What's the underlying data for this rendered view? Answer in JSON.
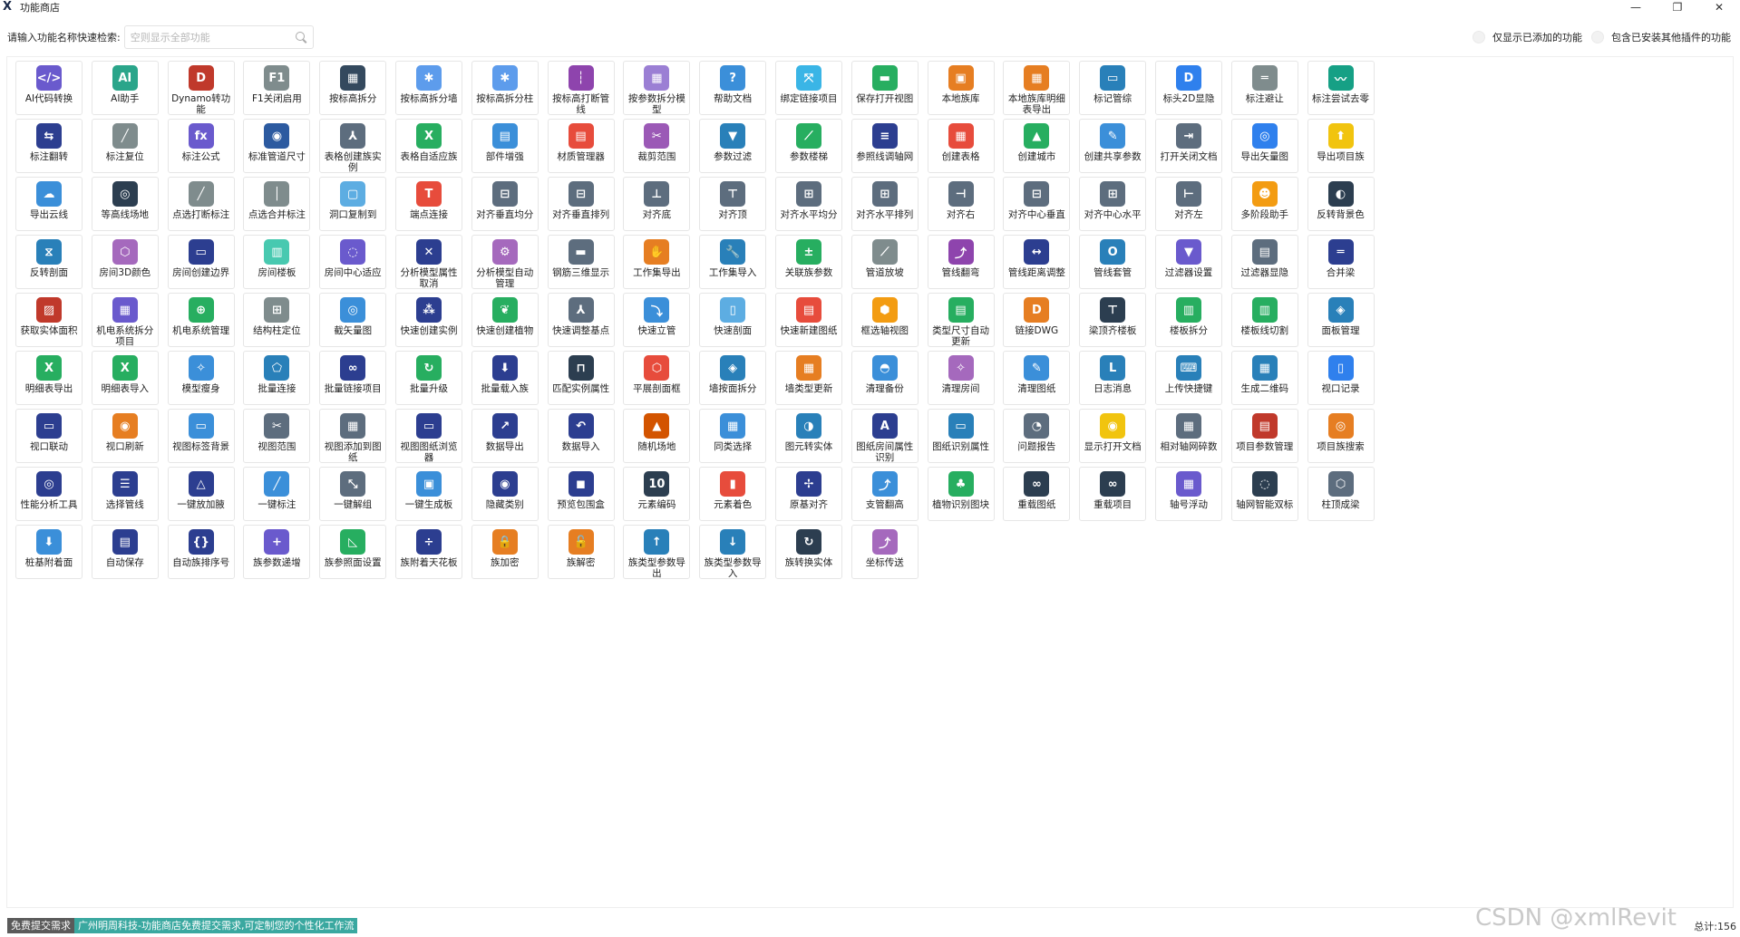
{
  "window": {
    "title": "功能商店",
    "app_icon": "X"
  },
  "search": {
    "label": "请输入功能名称快速检索:",
    "placeholder": "空则显示全部功能"
  },
  "toggles": [
    {
      "label": "仅显示已添加的功能"
    },
    {
      "label": "包含已安装其他插件的功能"
    }
  ],
  "footer": {
    "feedback": "免费提交需求",
    "banner": "广州明周科技-功能商店免费提交需求,可定制您的个性化工作流",
    "watermark": "CSDN @xmlRevit",
    "total": "总计:156"
  },
  "features": [
    {
      "label": "AI代码转换",
      "icon": "</>",
      "color": "#6a5acd"
    },
    {
      "label": "AI助手",
      "icon": "AI",
      "color": "#2aa58a"
    },
    {
      "label": "Dynamo转功能",
      "icon": "D",
      "color": "#c0392b"
    },
    {
      "label": "F1关闭启用",
      "icon": "F1",
      "color": "#7f8c8d"
    },
    {
      "label": "按标高拆分",
      "icon": "▦",
      "color": "#34495e"
    },
    {
      "label": "按标高拆分墙",
      "icon": "✱",
      "color": "#5d9cec"
    },
    {
      "label": "按标高拆分柱",
      "icon": "✱",
      "color": "#5d9cec"
    },
    {
      "label": "按标高打断管线",
      "icon": "┆",
      "color": "#8e44ad"
    },
    {
      "label": "按参数拆分模型",
      "icon": "▦",
      "color": "#9b7fd4"
    },
    {
      "label": "帮助文档",
      "icon": "?",
      "color": "#3b8fd9"
    },
    {
      "label": "绑定链接项目",
      "icon": "⤧",
      "color": "#3ab5e6"
    },
    {
      "label": "保存打开视图",
      "icon": "▬",
      "color": "#27ae60"
    },
    {
      "label": "本地族库",
      "icon": "▣",
      "color": "#e67e22"
    },
    {
      "label": "本地族库明细表导出",
      "icon": "▦",
      "color": "#e67e22"
    },
    {
      "label": "标记管综",
      "icon": "▭",
      "color": "#2980b9"
    },
    {
      "label": "标头2D显隐",
      "icon": "D",
      "color": "#2f80ed"
    },
    {
      "label": "标注避让",
      "icon": "═",
      "color": "#7f8c8d"
    },
    {
      "label": "标注尝试去零",
      "icon": "〰",
      "color": "#16a085"
    },
    {
      "label": "标注翻转",
      "icon": "⇆",
      "color": "#2c3e90"
    },
    {
      "label": "标注复位",
      "icon": "╱",
      "color": "#7f8c8d"
    },
    {
      "label": "标注公式",
      "icon": "fx",
      "color": "#6a5acd"
    },
    {
      "label": "标准管道尺寸",
      "icon": "◉",
      "color": "#2c5aa0"
    },
    {
      "label": "表格创建族实例",
      "icon": "⅄",
      "color": "#5d6d7e"
    },
    {
      "label": "表格自适应族",
      "icon": "X",
      "color": "#27ae60"
    },
    {
      "label": "部件增强",
      "icon": "▤",
      "color": "#3b8fd9"
    },
    {
      "label": "材质管理器",
      "icon": "▤",
      "color": "#e74c3c"
    },
    {
      "label": "裁剪范围",
      "icon": "✂",
      "color": "#9b59b6"
    },
    {
      "label": "参数过滤",
      "icon": "▼",
      "color": "#2980b9"
    },
    {
      "label": "参数楼梯",
      "icon": "⟋",
      "color": "#27ae60"
    },
    {
      "label": "参照线调轴网",
      "icon": "≡",
      "color": "#2c3e90"
    },
    {
      "label": "创建表格",
      "icon": "▦",
      "color": "#e74c3c"
    },
    {
      "label": "创建城市",
      "icon": "▲",
      "color": "#27ae60"
    },
    {
      "label": "创建共享参数",
      "icon": "✎",
      "color": "#3b8fd9"
    },
    {
      "label": "打开关闭文档",
      "icon": "⇥",
      "color": "#5d6d7e"
    },
    {
      "label": "导出矢量图",
      "icon": "◎",
      "color": "#2f80ed"
    },
    {
      "label": "导出项目族",
      "icon": "⬆",
      "color": "#f1c40f"
    },
    {
      "label": "导出云线",
      "icon": "☁",
      "color": "#3b8fd9"
    },
    {
      "label": "等高线场地",
      "icon": "◎",
      "color": "#2c3e50"
    },
    {
      "label": "点选打断标注",
      "icon": "╱",
      "color": "#7f8c8d"
    },
    {
      "label": "点选合并标注",
      "icon": "│",
      "color": "#7f8c8d"
    },
    {
      "label": "洞口复制到",
      "icon": "▢",
      "color": "#5dade2"
    },
    {
      "label": "端点连接",
      "icon": "T",
      "color": "#e74c3c"
    },
    {
      "label": "对齐垂直均分",
      "icon": "⊟",
      "color": "#5d6d7e"
    },
    {
      "label": "对齐垂直排列",
      "icon": "⊟",
      "color": "#5d6d7e"
    },
    {
      "label": "对齐底",
      "icon": "⊥",
      "color": "#5d6d7e"
    },
    {
      "label": "对齐顶",
      "icon": "⊤",
      "color": "#5d6d7e"
    },
    {
      "label": "对齐水平均分",
      "icon": "⊞",
      "color": "#5d6d7e"
    },
    {
      "label": "对齐水平排列",
      "icon": "⊞",
      "color": "#5d6d7e"
    },
    {
      "label": "对齐右",
      "icon": "⊣",
      "color": "#5d6d7e"
    },
    {
      "label": "对齐中心垂直",
      "icon": "⊟",
      "color": "#5d6d7e"
    },
    {
      "label": "对齐中心水平",
      "icon": "⊞",
      "color": "#5d6d7e"
    },
    {
      "label": "对齐左",
      "icon": "⊢",
      "color": "#5d6d7e"
    },
    {
      "label": "多阶段助手",
      "icon": "☻",
      "color": "#f39c12"
    },
    {
      "label": "反转背景色",
      "icon": "◐",
      "color": "#2c3e50"
    },
    {
      "label": "反转剖面",
      "icon": "⧖",
      "color": "#2980b9"
    },
    {
      "label": "房间3D颜色",
      "icon": "⬡",
      "color": "#a569bd"
    },
    {
      "label": "房间创建边界",
      "icon": "▭",
      "color": "#2c3e90"
    },
    {
      "label": "房间楼板",
      "icon": "▥",
      "color": "#48c9b0"
    },
    {
      "label": "房间中心适应",
      "icon": "◌",
      "color": "#6a5acd"
    },
    {
      "label": "分析模型属性取消",
      "icon": "✕",
      "color": "#2c3e90"
    },
    {
      "label": "分析模型自动管理",
      "icon": "⚙",
      "color": "#a569bd"
    },
    {
      "label": "钢筋三维显示",
      "icon": "▬",
      "color": "#5d6d7e"
    },
    {
      "label": "工作集导出",
      "icon": "✋",
      "color": "#e67e22"
    },
    {
      "label": "工作集导入",
      "icon": "🔧",
      "color": "#2980b9"
    },
    {
      "label": "关联族参数",
      "icon": "±",
      "color": "#27ae60"
    },
    {
      "label": "管道放坡",
      "icon": "⟋",
      "color": "#7f8c8d"
    },
    {
      "label": "管线翻弯",
      "icon": "⤴",
      "color": "#8e44ad"
    },
    {
      "label": "管线距离调整",
      "icon": "↔",
      "color": "#2c3e90"
    },
    {
      "label": "管线套管",
      "icon": "O",
      "color": "#2980b9"
    },
    {
      "label": "过滤器设置",
      "icon": "▼",
      "color": "#6a5acd"
    },
    {
      "label": "过滤器显隐",
      "icon": "▤",
      "color": "#5d6d7e"
    },
    {
      "label": "合并梁",
      "icon": "═",
      "color": "#2c3e90"
    },
    {
      "label": "获取实体面积",
      "icon": "▨",
      "color": "#c0392b"
    },
    {
      "label": "机电系统拆分项目",
      "icon": "▦",
      "color": "#6a5acd"
    },
    {
      "label": "机电系统管理",
      "icon": "⊕",
      "color": "#27ae60"
    },
    {
      "label": "结构柱定位",
      "icon": "⊞",
      "color": "#7f8c8d"
    },
    {
      "label": "截矢量图",
      "icon": "◎",
      "color": "#3b8fd9"
    },
    {
      "label": "快速创建实例",
      "icon": "⁂",
      "color": "#2c3e90"
    },
    {
      "label": "快速创建植物",
      "icon": "❦",
      "color": "#27ae60"
    },
    {
      "label": "快速调整基点",
      "icon": "⅄",
      "color": "#5d6d7e"
    },
    {
      "label": "快速立管",
      "icon": "⤵",
      "color": "#3b8fd9"
    },
    {
      "label": "快速剖面",
      "icon": "▯",
      "color": "#5dade2"
    },
    {
      "label": "快速新建图纸",
      "icon": "▤",
      "color": "#e74c3c"
    },
    {
      "label": "框选轴视图",
      "icon": "⬢",
      "color": "#f39c12"
    },
    {
      "label": "类型尺寸自动更新",
      "icon": "▤",
      "color": "#27ae60"
    },
    {
      "label": "链接DWG",
      "icon": "D",
      "color": "#e67e22"
    },
    {
      "label": "梁顶齐楼板",
      "icon": "⊤",
      "color": "#2c3e50"
    },
    {
      "label": "楼板拆分",
      "icon": "▥",
      "color": "#27ae60"
    },
    {
      "label": "楼板线切割",
      "icon": "▥",
      "color": "#27ae60"
    },
    {
      "label": "面板管理",
      "icon": "◈",
      "color": "#2980b9"
    },
    {
      "label": "明细表导出",
      "icon": "X",
      "color": "#27ae60"
    },
    {
      "label": "明细表导入",
      "icon": "X",
      "color": "#27ae60"
    },
    {
      "label": "模型瘦身",
      "icon": "✧",
      "color": "#3b8fd9"
    },
    {
      "label": "批量连接",
      "icon": "⬠",
      "color": "#2980b9"
    },
    {
      "label": "批量链接项目",
      "icon": "∞",
      "color": "#2c3e90"
    },
    {
      "label": "批量升级",
      "icon": "↻",
      "color": "#27ae60"
    },
    {
      "label": "批量载入族",
      "icon": "⬇",
      "color": "#2c3e90"
    },
    {
      "label": "匹配实例属性",
      "icon": "⊓",
      "color": "#2c3e50"
    },
    {
      "label": "平展剖面框",
      "icon": "⬡",
      "color": "#e74c3c"
    },
    {
      "label": "墙按面拆分",
      "icon": "◈",
      "color": "#2980b9"
    },
    {
      "label": "墙类型更新",
      "icon": "▦",
      "color": "#e67e22"
    },
    {
      "label": "清理备份",
      "icon": "◓",
      "color": "#3b8fd9"
    },
    {
      "label": "清理房间",
      "icon": "✧",
      "color": "#a569bd"
    },
    {
      "label": "清理图纸",
      "icon": "✎",
      "color": "#3b8fd9"
    },
    {
      "label": "日志消息",
      "icon": "L",
      "color": "#2980b9"
    },
    {
      "label": "上传快捷键",
      "icon": "⌨",
      "color": "#2980b9"
    },
    {
      "label": "生成二维码",
      "icon": "▦",
      "color": "#2980b9"
    },
    {
      "label": "视口记录",
      "icon": "▯",
      "color": "#2f80ed"
    },
    {
      "label": "视口联动",
      "icon": "▭",
      "color": "#2c3e90"
    },
    {
      "label": "视口刷新",
      "icon": "◉",
      "color": "#e67e22"
    },
    {
      "label": "视图标签背景",
      "icon": "▭",
      "color": "#3b8fd9"
    },
    {
      "label": "视图范围",
      "icon": "✂",
      "color": "#5d6d7e"
    },
    {
      "label": "视图添加到图纸",
      "icon": "▦",
      "color": "#5d6d7e"
    },
    {
      "label": "视图图纸浏览器",
      "icon": "▭",
      "color": "#2c3e90"
    },
    {
      "label": "数据导出",
      "icon": "↗",
      "color": "#2c3e90"
    },
    {
      "label": "数据导入",
      "icon": "↶",
      "color": "#2c3e90"
    },
    {
      "label": "随机场地",
      "icon": "▲",
      "color": "#d35400"
    },
    {
      "label": "同类选择",
      "icon": "▦",
      "color": "#3b8fd9"
    },
    {
      "label": "图元转实体",
      "icon": "◑",
      "color": "#2980b9"
    },
    {
      "label": "图纸房间属性识别",
      "icon": "A",
      "color": "#2c3e90"
    },
    {
      "label": "图纸识别属性",
      "icon": "▭",
      "color": "#2980b9"
    },
    {
      "label": "问题报告",
      "icon": "◔",
      "color": "#5d6d7e"
    },
    {
      "label": "显示打开文档",
      "icon": "◉",
      "color": "#f1c40f"
    },
    {
      "label": "相对轴网碎数",
      "icon": "▦",
      "color": "#5d6d7e"
    },
    {
      "label": "项目参数管理",
      "icon": "▤",
      "color": "#c0392b"
    },
    {
      "label": "项目族搜索",
      "icon": "◎",
      "color": "#e67e22"
    },
    {
      "label": "性能分析工具",
      "icon": "◎",
      "color": "#2c3e90"
    },
    {
      "label": "选择管线",
      "icon": "☰",
      "color": "#2c3e90"
    },
    {
      "label": "一键放加腋",
      "icon": "△",
      "color": "#2c3e90"
    },
    {
      "label": "一键标注",
      "icon": "╱",
      "color": "#3b8fd9"
    },
    {
      "label": "一键解组",
      "icon": "⤡",
      "color": "#5d6d7e"
    },
    {
      "label": "一键生成板",
      "icon": "▣",
      "color": "#3b8fd9"
    },
    {
      "label": "隐藏类别",
      "icon": "◉",
      "color": "#2c3e90"
    },
    {
      "label": "预览包围盒",
      "icon": "◼",
      "color": "#2c3e90"
    },
    {
      "label": "元素编码",
      "icon": "10",
      "color": "#2c3e50"
    },
    {
      "label": "元素着色",
      "icon": "▮",
      "color": "#e74c3c"
    },
    {
      "label": "原基对齐",
      "icon": "✢",
      "color": "#2c3e90"
    },
    {
      "label": "支管翻高",
      "icon": "⤴",
      "color": "#3b8fd9"
    },
    {
      "label": "植物识别图块",
      "icon": "♣",
      "color": "#27ae60"
    },
    {
      "label": "重载图纸",
      "icon": "∞",
      "color": "#2c3e50"
    },
    {
      "label": "重载项目",
      "icon": "∞",
      "color": "#2c3e50"
    },
    {
      "label": "轴号浮动",
      "icon": "▦",
      "color": "#6a5acd"
    },
    {
      "label": "轴网智能双标",
      "icon": "◌",
      "color": "#2c3e50"
    },
    {
      "label": "柱顶成梁",
      "icon": "⬡",
      "color": "#5d6d7e"
    },
    {
      "label": "桩基附着面",
      "icon": "⬇",
      "color": "#3b8fd9"
    },
    {
      "label": "自动保存",
      "icon": "▤",
      "color": "#2c3e90"
    },
    {
      "label": "自动族排序号",
      "icon": "{}",
      "color": "#2c3e90"
    },
    {
      "label": "族参数递增",
      "icon": "+",
      "color": "#6a5acd"
    },
    {
      "label": "族参照面设置",
      "icon": "◺",
      "color": "#27ae60"
    },
    {
      "label": "族附着天花板",
      "icon": "÷",
      "color": "#2c3e90"
    },
    {
      "label": "族加密",
      "icon": "🔒",
      "color": "#e67e22"
    },
    {
      "label": "族解密",
      "icon": "🔓",
      "color": "#e67e22"
    },
    {
      "label": "族类型参数导出",
      "icon": "↑",
      "color": "#2980b9"
    },
    {
      "label": "族类型参数导入",
      "icon": "↓",
      "color": "#2980b9"
    },
    {
      "label": "族转换实体",
      "icon": "↻",
      "color": "#2c3e50"
    },
    {
      "label": "坐标传送",
      "icon": "⤴",
      "color": "#a569bd"
    }
  ]
}
